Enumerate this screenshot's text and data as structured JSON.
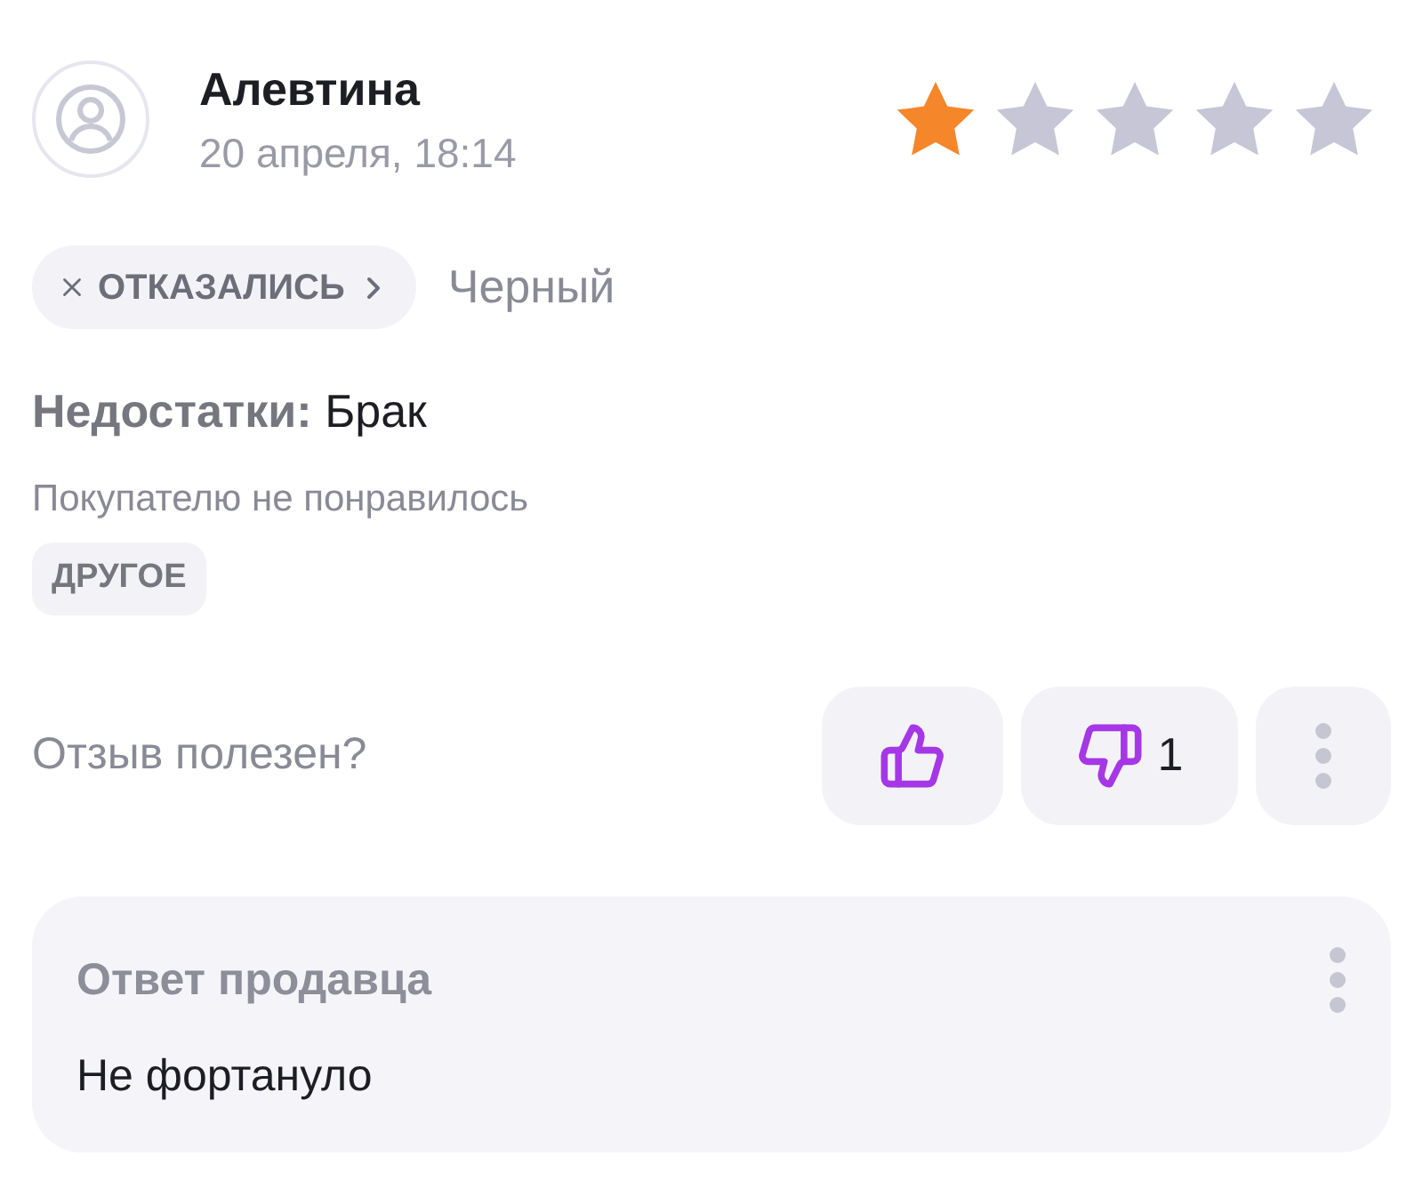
{
  "review": {
    "author": "Алевтина",
    "date": "20 апреля, 18:14",
    "stars": 1,
    "status_chip": "ОТКАЗАЛИСЬ",
    "variant": "Черный",
    "cons": {
      "label": "Недостатки:",
      "value": "Брак"
    },
    "comment": "Покупателю не понравилось",
    "tag": "ДРУГОЕ",
    "helpful_question": "Отзыв полезен?",
    "dislikes_count": "1"
  },
  "seller_reply": {
    "title": "Ответ продавца",
    "text": "Не фортануло"
  }
}
